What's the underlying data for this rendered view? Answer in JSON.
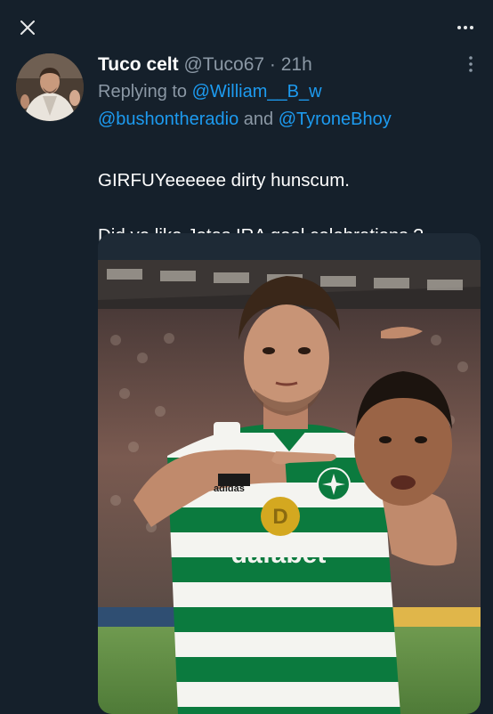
{
  "nav": {
    "close_icon": "close-icon",
    "more_icon": "more-horizontal-icon"
  },
  "tweet": {
    "display_name": "Tuco celt",
    "handle": "@Tuco67",
    "separator": "·",
    "time": "21h",
    "replying_prefix": "Replying to",
    "mentions": [
      "@William__B_w",
      "@bushontheradio",
      "@TyroneBhoy"
    ],
    "mention_joiner": "and",
    "text_line1": "GIRFUYeeeeee dirty hunscum.",
    "text_line2": "Did ye like Jotas IRA goal celebrations  ?",
    "emoji": "champagne-bottle-emoji",
    "options_icon": "more-vertical-icon"
  },
  "media": {
    "kit_logo": "adidas",
    "sponsor": "dafabet",
    "colors": {
      "hoop_green": "#0b7a3e",
      "hoop_white": "#f4f4f0"
    }
  },
  "colors": {
    "background": "#15202b",
    "link": "#1d9bf0",
    "secondary_text": "#8b98a5"
  }
}
